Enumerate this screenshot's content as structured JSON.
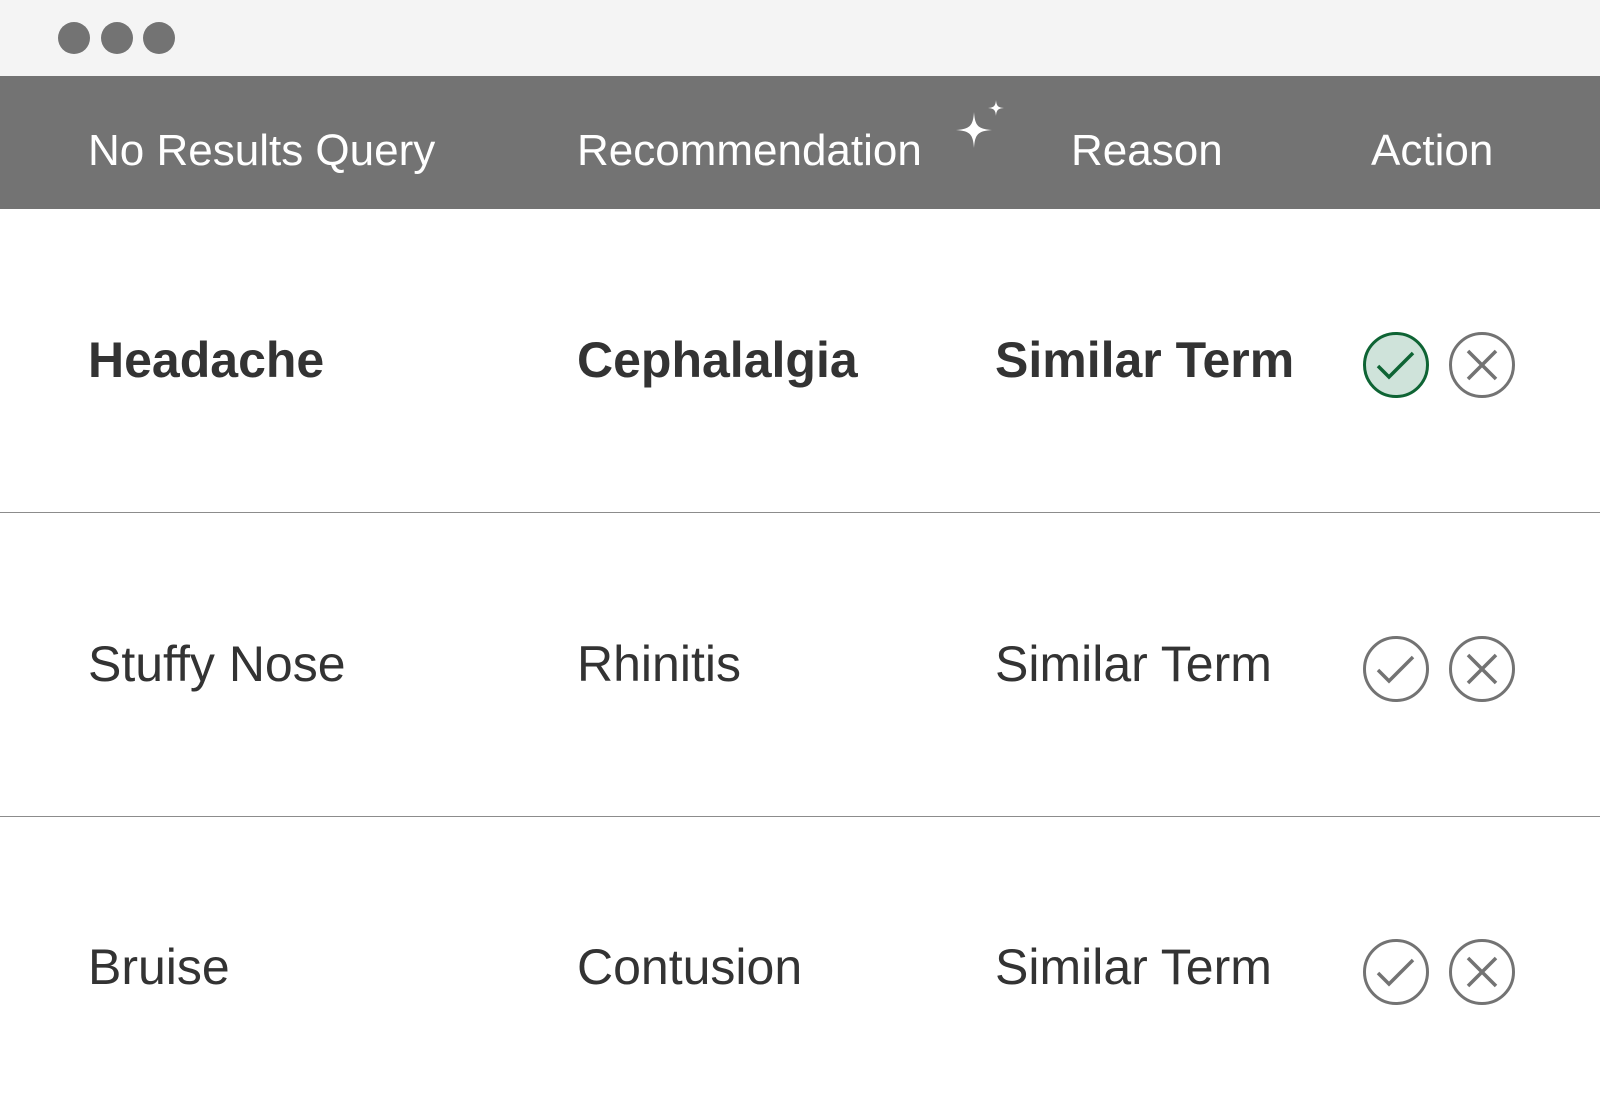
{
  "window": {
    "controls": [
      "dot",
      "dot",
      "dot"
    ]
  },
  "header": {
    "columns": [
      "No Results Query",
      "Recommendation",
      "Reason",
      "Action"
    ],
    "ai_icon": "sparkle-icon"
  },
  "rows": [
    {
      "query": "Headache",
      "recommendation": "Cephalalgia",
      "reason": "Similar Term",
      "accepted": true,
      "emphasis": "bold"
    },
    {
      "query": "Stuffy Nose",
      "recommendation": "Rhinitis",
      "reason": "Similar Term",
      "accepted": false,
      "emphasis": "normal"
    },
    {
      "query": "Bruise",
      "recommendation": "Contusion",
      "reason": "Similar Term",
      "accepted": false,
      "emphasis": "normal"
    }
  ],
  "icons": {
    "accept": "check-circle-icon",
    "reject": "x-circle-icon"
  },
  "colors": {
    "header_bg": "#737373",
    "titlebar_bg": "#f4f4f4",
    "accept_active": "#0e6434",
    "accept_active_fill": "#cfe3da",
    "icon_neutral": "#737373",
    "text": "#333333"
  }
}
